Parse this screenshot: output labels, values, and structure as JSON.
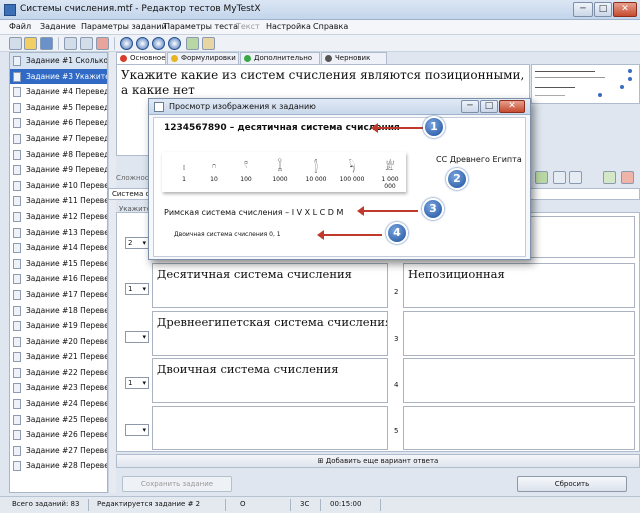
{
  "window": {
    "title": "Системы счисления.mtf - Редактор тестов MyTestX",
    "buttons": [
      "─",
      "□",
      "✕"
    ]
  },
  "menu": [
    {
      "label": "Файл",
      "enabled": true
    },
    {
      "label": "Задание",
      "enabled": true
    },
    {
      "label": "Параметры заданий",
      "enabled": true
    },
    {
      "label": "Параметры теста",
      "enabled": true
    },
    {
      "label": "Текст",
      "enabled": false
    },
    {
      "label": "Настройка",
      "enabled": true
    },
    {
      "label": "Справка",
      "enabled": true
    }
  ],
  "sidebar": {
    "items": [
      "Задание #1 Сколько",
      "Задание #3 Укажите",
      "Задание #4 Перевед",
      "Задание #5 Перевед",
      "Задание #6 Перевед",
      "Задание #7 Перевед",
      "Задание #8 Перевед",
      "Задание #9 Перевед",
      "Задание #10 Перевед",
      "Задание #11 Перевед",
      "Задание #12 Перевед",
      "Задание #13 Перевед",
      "Задание #14 Перевед",
      "Задание #15 Перевед",
      "Задание #16 Перевед",
      "Задание #17 Перевед",
      "Задание #18 Перевед",
      "Задание #19 Перевед",
      "Задание #20 Перевед",
      "Задание #21 Перевед",
      "Задание #22 Перевед",
      "Задание #23 Перевед",
      "Задание #24 Перевед",
      "Задание #25 Перевед",
      "Задание #26 Перевед",
      "Задание #27 Перевед",
      "Задание #28 Перевед"
    ]
  },
  "tabs": [
    {
      "label": "Основное",
      "color": "#d93a2b"
    },
    {
      "label": "Формулировки",
      "color": "#e8b51e"
    },
    {
      "label": "Дополнительно",
      "color": "#39a845"
    },
    {
      "label": "Черновик",
      "color": "#555555"
    }
  ],
  "question": {
    "text": "Укажите какие из систем счисления являются позиционными, а какие нет"
  },
  "answer_area": {
    "complexity_label": "Сложность",
    "type_select": "Система сч",
    "hint": "Укажите",
    "left_selects": [
      "2",
      "1",
      "",
      "1",
      ""
    ],
    "left_cells": [
      "",
      "Десятичная система счисления",
      "Древнеегипетская система счисления",
      "Двоичная система счисления",
      ""
    ],
    "right_numbers": [
      "",
      "2",
      "3",
      "4",
      "5"
    ],
    "right_cells": [
      "",
      "Непозиционная",
      "",
      "",
      ""
    ],
    "add_variant": "Добавить еще вариант ответа",
    "save_button": "Сохранить задание",
    "reset_button": "Сбросить"
  },
  "status": {
    "total": "Всего заданий: 83",
    "editing": "Редактируется задание # 2",
    "o_label": "O",
    "cc_label": "3С",
    "time": "00:15:00"
  },
  "dialog": {
    "title": "Просмотр изображения к заданию",
    "line1": "1234567890 – десятичная система счисления",
    "egypt_glyphs": [
      "𓏤",
      "𓎆",
      "𓍢",
      "𓆼",
      "𓂭",
      "𓆐",
      "𓁨"
    ],
    "egypt_numbers": [
      "1",
      "10",
      "100",
      "1000",
      "10 000",
      "100 000",
      "1 000 000"
    ],
    "egypt_label": "СС Древнего Египта",
    "roman": "Римская система счисления – I V X L C D M",
    "binary": "Двоичная система счисления 0, 1",
    "badges": [
      "1",
      "2",
      "3",
      "4"
    ]
  }
}
